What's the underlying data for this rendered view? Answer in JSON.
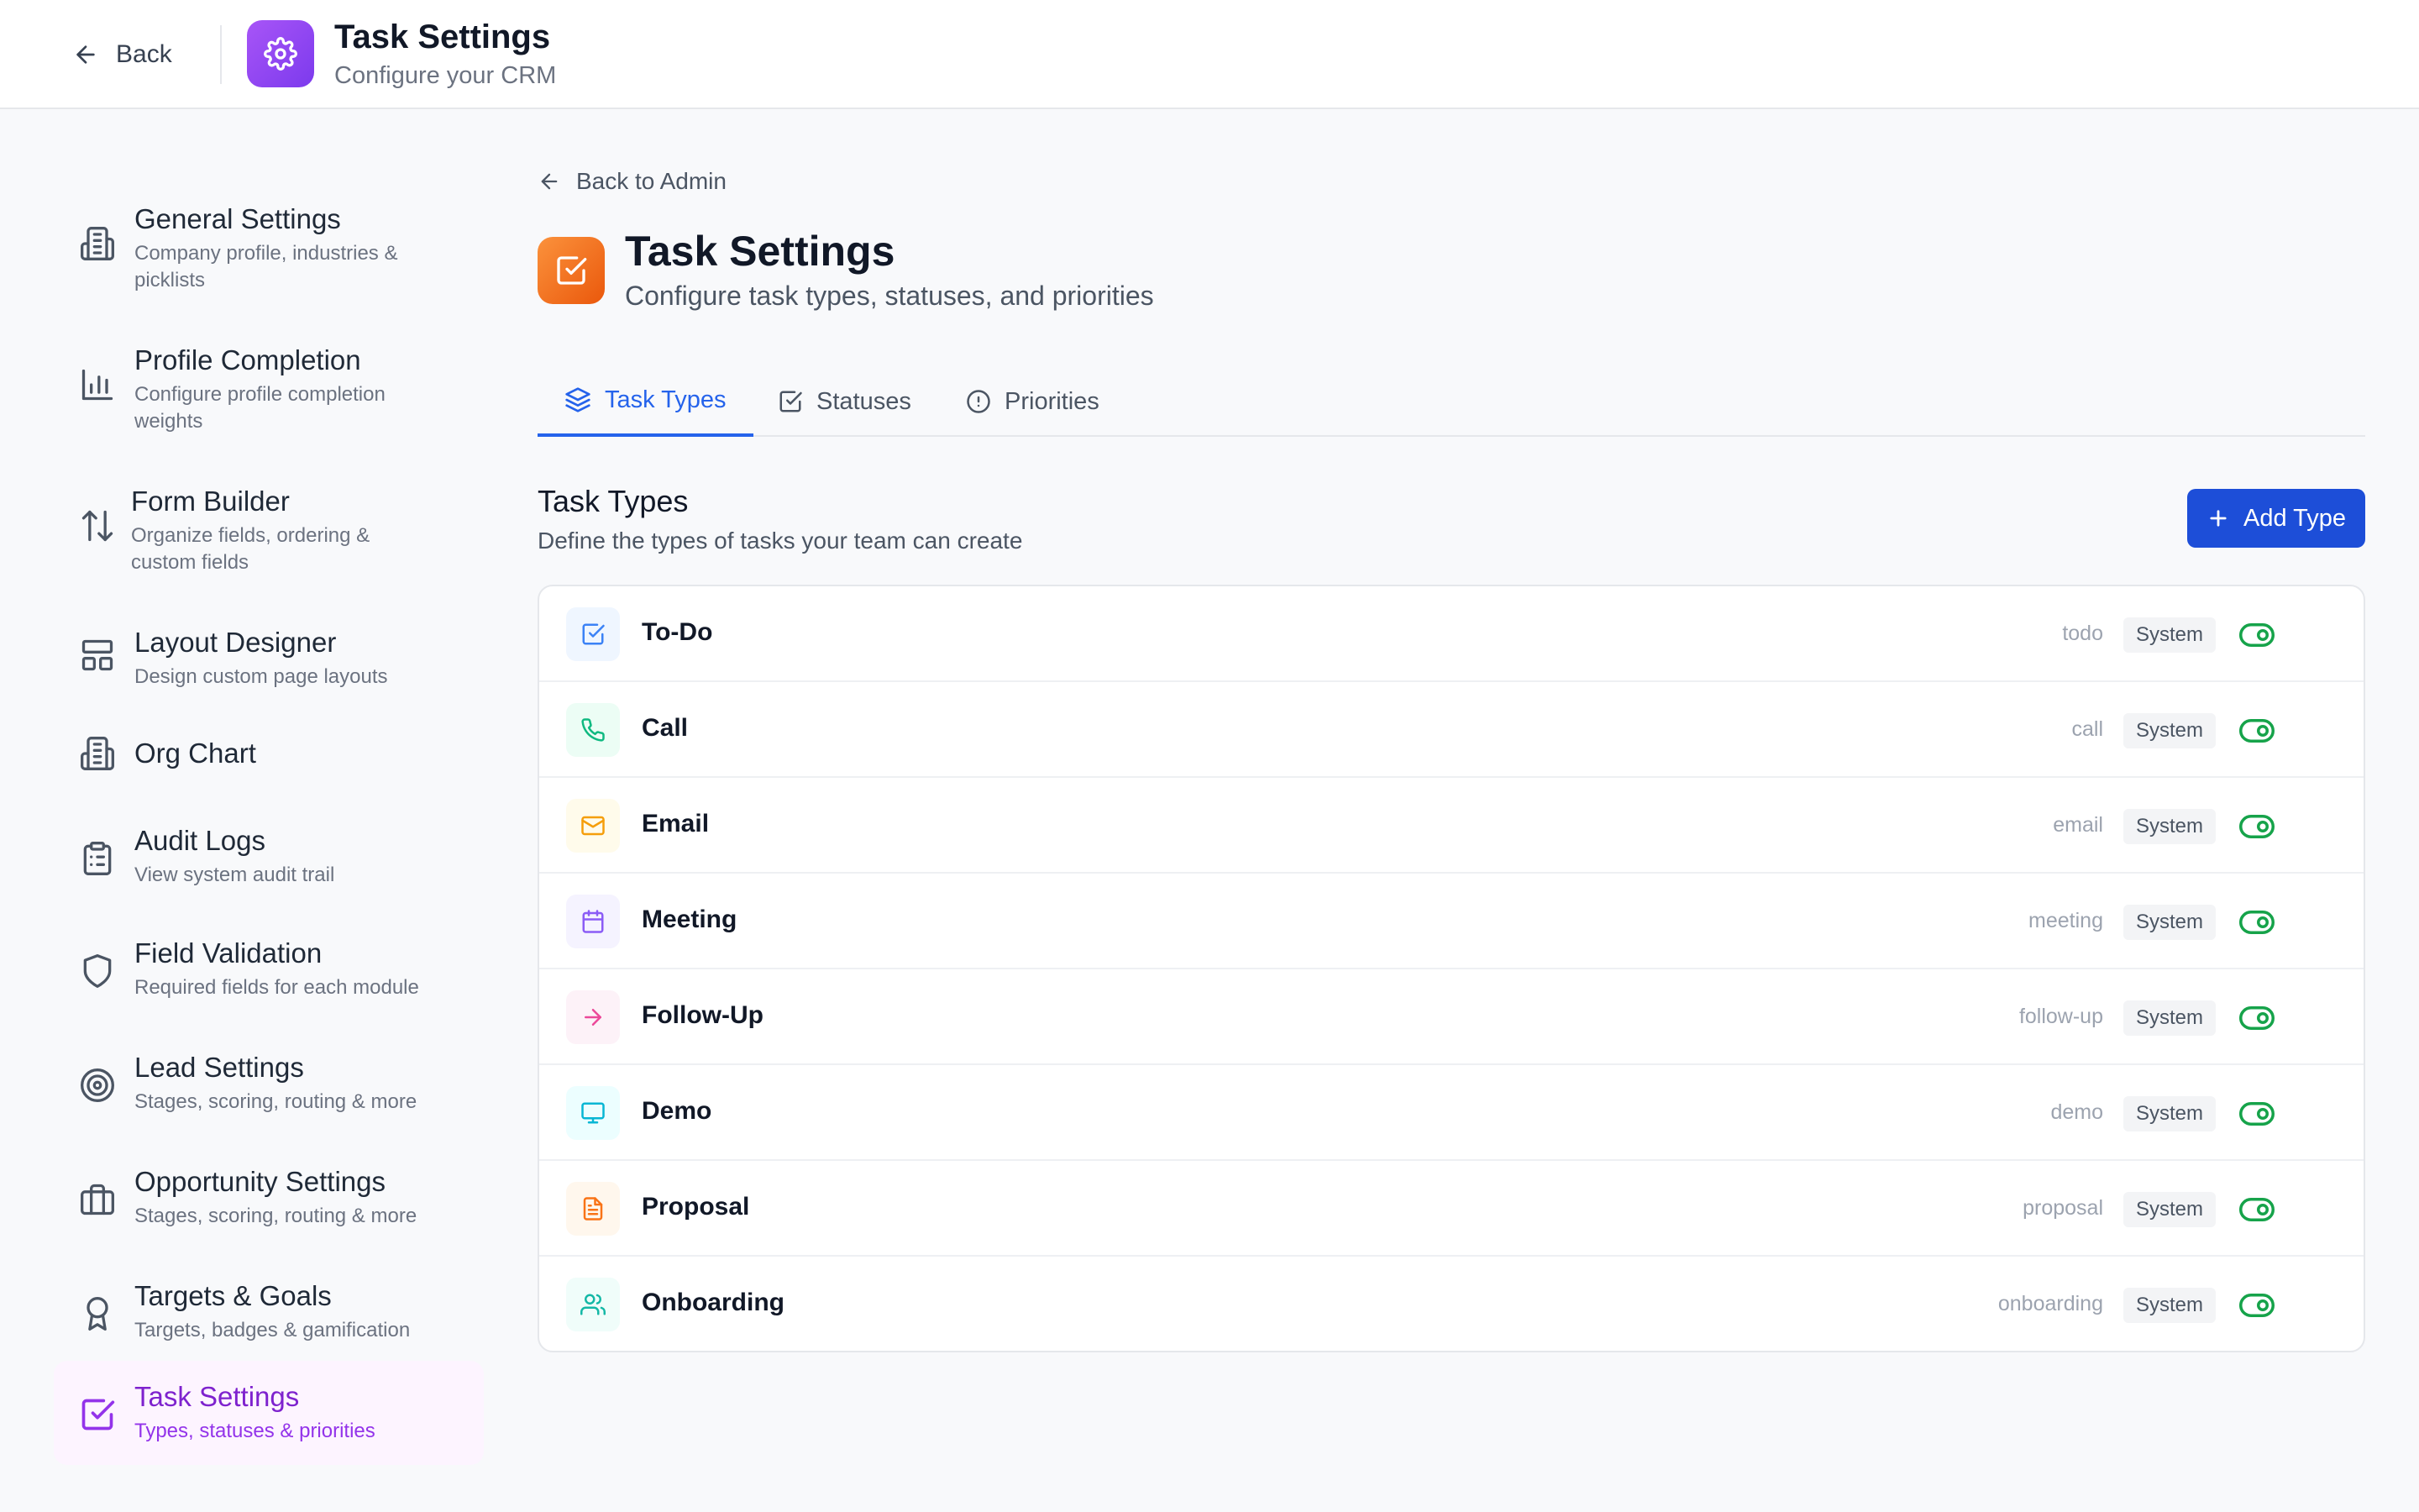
{
  "header": {
    "back_label": "Back",
    "title": "Task Settings",
    "subtitle": "Configure your CRM",
    "badge_color": "#8b5cf6"
  },
  "sidebar": {
    "items": [
      {
        "title": "General Settings",
        "desc": "Company profile, industries & picklists",
        "icon": "building-icon"
      },
      {
        "title": "Profile Completion",
        "desc": "Configure profile completion weights",
        "icon": "bar-chart-icon"
      },
      {
        "title": "Form Builder",
        "desc": "Organize fields, ordering & custom fields",
        "icon": "sort-arrows-icon"
      },
      {
        "title": "Layout Designer",
        "desc": "Design custom page layouts",
        "icon": "layout-icon"
      },
      {
        "title": "Org Chart",
        "desc": "",
        "icon": "building-icon"
      },
      {
        "title": "Audit Logs",
        "desc": "View system audit trail",
        "icon": "clipboard-list-icon"
      },
      {
        "title": "Field Validation",
        "desc": "Required fields for each module",
        "icon": "shield-icon"
      },
      {
        "title": "Lead Settings",
        "desc": "Stages, scoring, routing & more",
        "icon": "target-icon"
      },
      {
        "title": "Opportunity Settings",
        "desc": "Stages, scoring, routing & more",
        "icon": "briefcase-icon"
      },
      {
        "title": "Targets & Goals",
        "desc": "Targets, badges & gamification",
        "icon": "award-icon"
      },
      {
        "title": "Task Settings",
        "desc": "Types, statuses & priorities",
        "icon": "check-square-icon",
        "active": true
      }
    ]
  },
  "main": {
    "back_admin_label": "Back to Admin",
    "title": "Task Settings",
    "subtitle": "Configure task types, statuses, and priorities",
    "tabs": [
      {
        "label": "Task Types",
        "icon": "layers-icon",
        "active": true
      },
      {
        "label": "Statuses",
        "icon": "check-square-icon"
      },
      {
        "label": "Priorities",
        "icon": "alert-circle-icon"
      }
    ],
    "section_title": "Task Types",
    "section_subtitle": "Define the types of tasks your team can create",
    "add_button_label": "Add Type",
    "task_types": [
      {
        "name": "To-Do",
        "key": "todo",
        "badge": "System",
        "icon": "check-square-icon",
        "color": "#3b82f6",
        "bg": "#eff6ff",
        "enabled": true
      },
      {
        "name": "Call",
        "key": "call",
        "badge": "System",
        "icon": "phone-icon",
        "color": "#10b981",
        "bg": "#ecfdf5",
        "enabled": true
      },
      {
        "name": "Email",
        "key": "email",
        "badge": "System",
        "icon": "mail-icon",
        "color": "#f59e0b",
        "bg": "#fffbeb",
        "enabled": true
      },
      {
        "name": "Meeting",
        "key": "meeting",
        "badge": "System",
        "icon": "calendar-icon",
        "color": "#8b5cf6",
        "bg": "#f5f3ff",
        "enabled": true
      },
      {
        "name": "Follow-Up",
        "key": "follow-up",
        "badge": "System",
        "icon": "arrow-right-icon",
        "color": "#ec4899",
        "bg": "#fdf2f8",
        "enabled": true
      },
      {
        "name": "Demo",
        "key": "demo",
        "badge": "System",
        "icon": "monitor-icon",
        "color": "#06b6d4",
        "bg": "#ecfeff",
        "enabled": true
      },
      {
        "name": "Proposal",
        "key": "proposal",
        "badge": "System",
        "icon": "file-text-icon",
        "color": "#f97316",
        "bg": "#fff7ed",
        "enabled": true
      },
      {
        "name": "Onboarding",
        "key": "onboarding",
        "badge": "System",
        "icon": "users-icon",
        "color": "#14b8a6",
        "bg": "#f0fdfa",
        "enabled": true
      }
    ],
    "toggle_color": "#16a34a"
  }
}
